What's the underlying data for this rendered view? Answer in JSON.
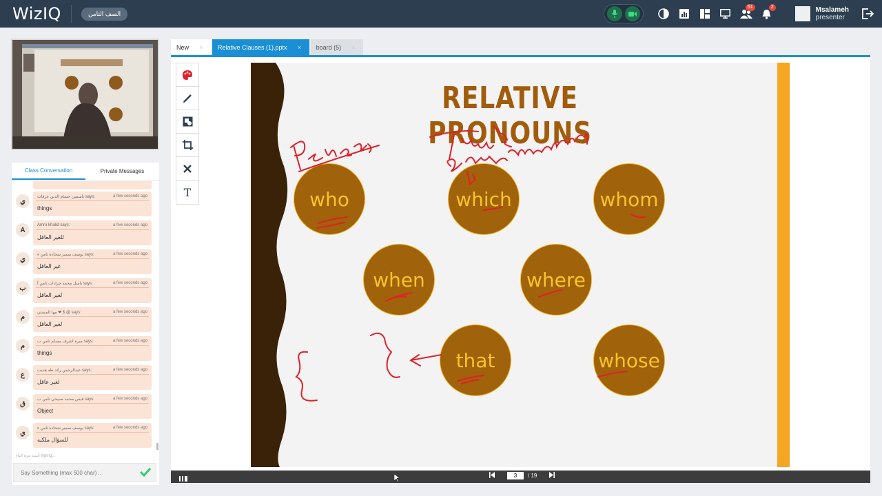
{
  "header": {
    "logo": "WizIQ",
    "class_name": "الصف الثامن",
    "attendees_badge": "51",
    "notifications_badge": "2",
    "user_name": "Msalameh",
    "user_role": "presenter"
  },
  "chat": {
    "tabs": [
      "Class Conversation",
      "Private Messages"
    ],
    "messages": [
      {
        "initial": "ي",
        "sender": "ياسمين حسام الدين عرفات says:",
        "time": "a few seconds ago",
        "text": "things"
      },
      {
        "initial": "A",
        "sender": "Amro khalid says:",
        "time": "a few seconds ago",
        "text": "للغير العاقل"
      },
      {
        "initial": "ي",
        "sender": "يوسف سمير شحادة ثامن ء says:",
        "time": "a few seconds ago",
        "text": "غير العاقل"
      },
      {
        "initial": "ب",
        "sender": "باسل محمد جرادات ثامن أ says:",
        "time": "a few seconds ago",
        "text": "لغير العاقل"
      },
      {
        "initial": "م",
        "sender": "مها المستي ❤ $ @ says:",
        "time": "a few seconds ago",
        "text": "لغير العاقل"
      },
      {
        "initial": "م",
        "sender": "ميرة اشرف مسلم ثامن ب says:",
        "time": "a few seconds ago",
        "text": "things"
      },
      {
        "initial": "ع",
        "sender": "عبدالرحمن رائد طه هديب says:",
        "time": "a few seconds ago",
        "text": "لغير عاقل"
      },
      {
        "initial": "ق",
        "sender": "قيس محمد صبيحي ثامن ب says:",
        "time": "a few seconds ago",
        "text": "Object"
      },
      {
        "initial": "ي",
        "sender": "يوسف سمير شحادة ثامن ء says:",
        "time": "a few seconds ago",
        "text": "للسؤال ملكيه"
      }
    ],
    "typing": "أسيد مرة الباء typing...",
    "input_placeholder": "Say Something (max 500 char) .."
  },
  "tabs": [
    {
      "label": "New"
    },
    {
      "label": "Relative Clauses (1).pptx"
    },
    {
      "label": "board (5)"
    }
  ],
  "slide": {
    "title": "RELATIVE PRONOUNS",
    "pronouns": [
      "who",
      "which",
      "whom",
      "when",
      "where",
      "that",
      "whose"
    ],
    "annotations": {
      "person": "Person",
      "things": "Things",
      "animals": "animals"
    }
  },
  "pager": {
    "current": "3",
    "total": "/ 19"
  },
  "colors": {
    "topbar": "#2c3e50",
    "accent": "#1a8fd6",
    "bubble": "#a0620a",
    "bubble_text": "#f6c528",
    "title": "#a15c0b",
    "orange_bar": "#f5a623",
    "ink": "#e0202a"
  }
}
